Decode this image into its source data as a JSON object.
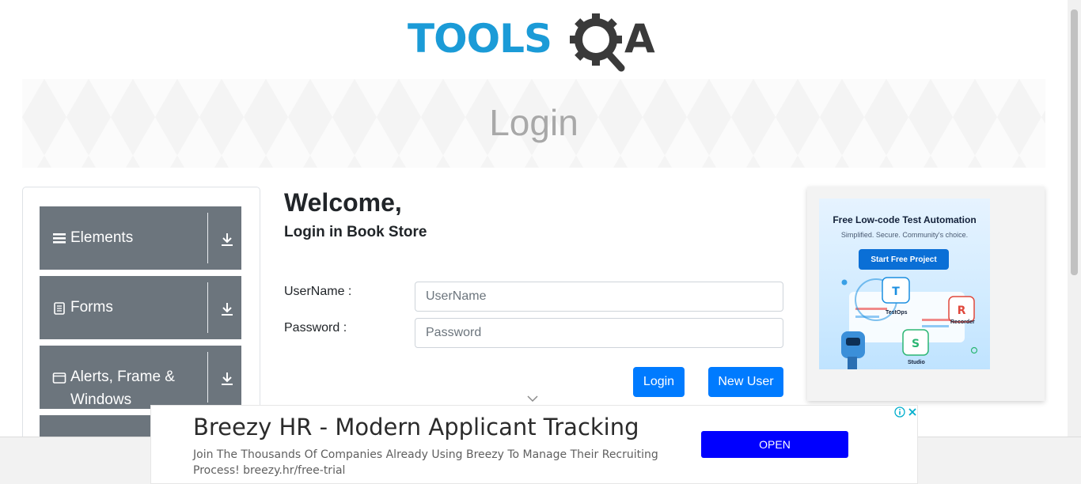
{
  "header": {
    "logo_left": "TOOLS",
    "logo_right": "A"
  },
  "banner": {
    "title": "Login"
  },
  "sidebar": {
    "groups": [
      {
        "label": "Elements",
        "icon": "hamburger-icon"
      },
      {
        "label": "Forms",
        "icon": "document-icon"
      },
      {
        "label": "Alerts, Frame & Windows",
        "icon": "window-icon"
      },
      {
        "label": "",
        "icon": ""
      }
    ]
  },
  "login": {
    "welcome": "Welcome,",
    "subtitle": "Login in Book Store",
    "username_label": "UserName :",
    "username_placeholder": "UserName",
    "password_label": "Password :",
    "password_placeholder": "Password",
    "login_button": "Login",
    "new_user_button": "New User"
  },
  "side_ad": {
    "title": "Free Low-code Test Automation",
    "subtitle": "Simplified. Secure. Community's choice.",
    "cta": "Start Free Project",
    "tags": [
      "TestOps",
      "Recorder",
      "Studio"
    ]
  },
  "bottom_ad": {
    "title": "Breezy HR - Modern Applicant Tracking",
    "description": "Join The Thousands Of Companies Already Using Breezy To Manage Their Recruiting Process! breezy.hr/free-trial",
    "open_button": "OPEN"
  },
  "colors": {
    "primary": "#007bff",
    "sidebar_group": "#6c757d",
    "logo_blue": "#1b9bd7",
    "logo_dark": "#3a3a3a",
    "ad_open": "#0000ff"
  }
}
